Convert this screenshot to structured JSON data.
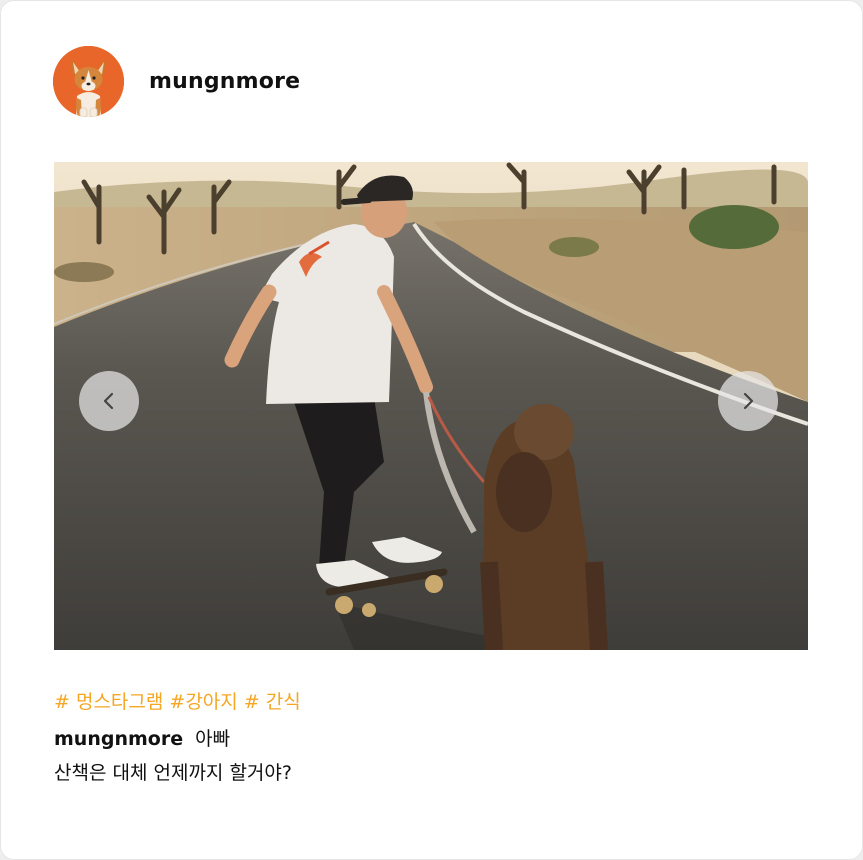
{
  "post": {
    "username": "mungnmore",
    "avatar_icon": "corgi-avatar",
    "image_alt": "man skateboarding on a desert road walking a brown poodle dog",
    "hashtags": "# 멍스타그램 #강아지 # 간식",
    "caption_user": "mungnmore",
    "caption_line1": "아빠",
    "caption_line2": "산책은 대체 언제까지 할거야?"
  },
  "carousel": {
    "prev_icon": "chevron-left-icon",
    "next_icon": "chevron-right-icon"
  },
  "colors": {
    "hashtag": "#f5a623",
    "avatar_bg": "#e8662a"
  }
}
